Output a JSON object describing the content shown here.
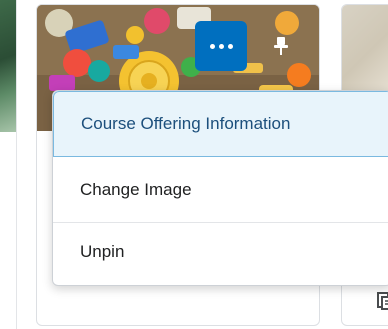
{
  "menu": {
    "items": [
      {
        "label": "Course Offering Information",
        "active": true
      },
      {
        "label": "Change Image",
        "active": false
      },
      {
        "label": "Unpin",
        "active": false
      }
    ]
  },
  "card": {
    "more_button_icon": "ellipsis-icon",
    "pin_icon": "pin-icon"
  },
  "colors": {
    "accent": "#006fbf",
    "menu_highlight": "#e8f4fb",
    "menu_highlight_border": "#7ab9e0"
  }
}
